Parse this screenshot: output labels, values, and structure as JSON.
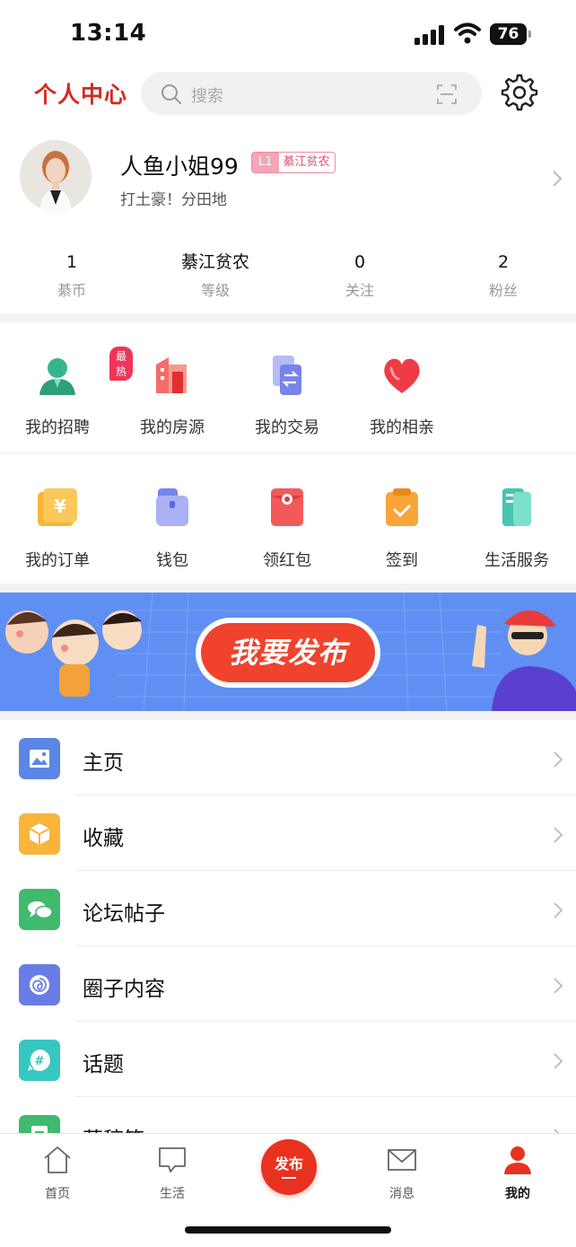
{
  "status_bar": {
    "time": "13:14",
    "battery": "76"
  },
  "header": {
    "title": "个人中心",
    "search_placeholder": "搜索"
  },
  "profile": {
    "username": "人鱼小姐99",
    "level_code": "L1",
    "level_name": "綦江贫农",
    "bio": "打土豪！分田地"
  },
  "stats": [
    {
      "value": "1",
      "label": "綦币"
    },
    {
      "value": "綦江贫农",
      "label": "等级"
    },
    {
      "value": "0",
      "label": "关注"
    },
    {
      "value": "2",
      "label": "粉丝"
    }
  ],
  "quick_row_1": [
    {
      "label": "我的招聘",
      "icon": "recruit-icon",
      "badge": "最热"
    },
    {
      "label": "我的房源",
      "icon": "house-icon"
    },
    {
      "label": "我的交易",
      "icon": "trade-icon"
    },
    {
      "label": "我的相亲",
      "icon": "heart-icon"
    }
  ],
  "quick_row_2": [
    {
      "label": "我的订单",
      "icon": "order-icon"
    },
    {
      "label": "钱包",
      "icon": "wallet-icon"
    },
    {
      "label": "领红包",
      "icon": "red-packet-icon"
    },
    {
      "label": "签到",
      "icon": "checkin-icon"
    },
    {
      "label": "生活服务",
      "icon": "life-service-icon"
    }
  ],
  "banner": {
    "button_text": "我要发布"
  },
  "menu": [
    {
      "label": "主页",
      "icon": "image-icon",
      "color": "#5b86e5"
    },
    {
      "label": "收藏",
      "icon": "box-icon",
      "color": "#f9b43a"
    },
    {
      "label": "论坛帖子",
      "icon": "chat-icon",
      "color": "#3fba6e"
    },
    {
      "label": "圈子内容",
      "icon": "spiral-icon",
      "color": "#6a7de6"
    },
    {
      "label": "话题",
      "icon": "hashtag-icon",
      "color": "#36c7c0"
    },
    {
      "label": "草稿箱",
      "icon": "draft-icon",
      "color": "#3fba6e"
    }
  ],
  "tab_bar": [
    {
      "label": "首页",
      "icon": "home-icon"
    },
    {
      "label": "生活",
      "icon": "message-square-icon"
    },
    {
      "label": "发布",
      "icon": "publish-icon"
    },
    {
      "label": "消息",
      "icon": "mail-icon"
    },
    {
      "label": "我的",
      "icon": "user-icon",
      "active": true
    }
  ],
  "colors": {
    "brand": "#d42b1e",
    "publish": "#e8321f",
    "banner": "#5f8ff2"
  }
}
